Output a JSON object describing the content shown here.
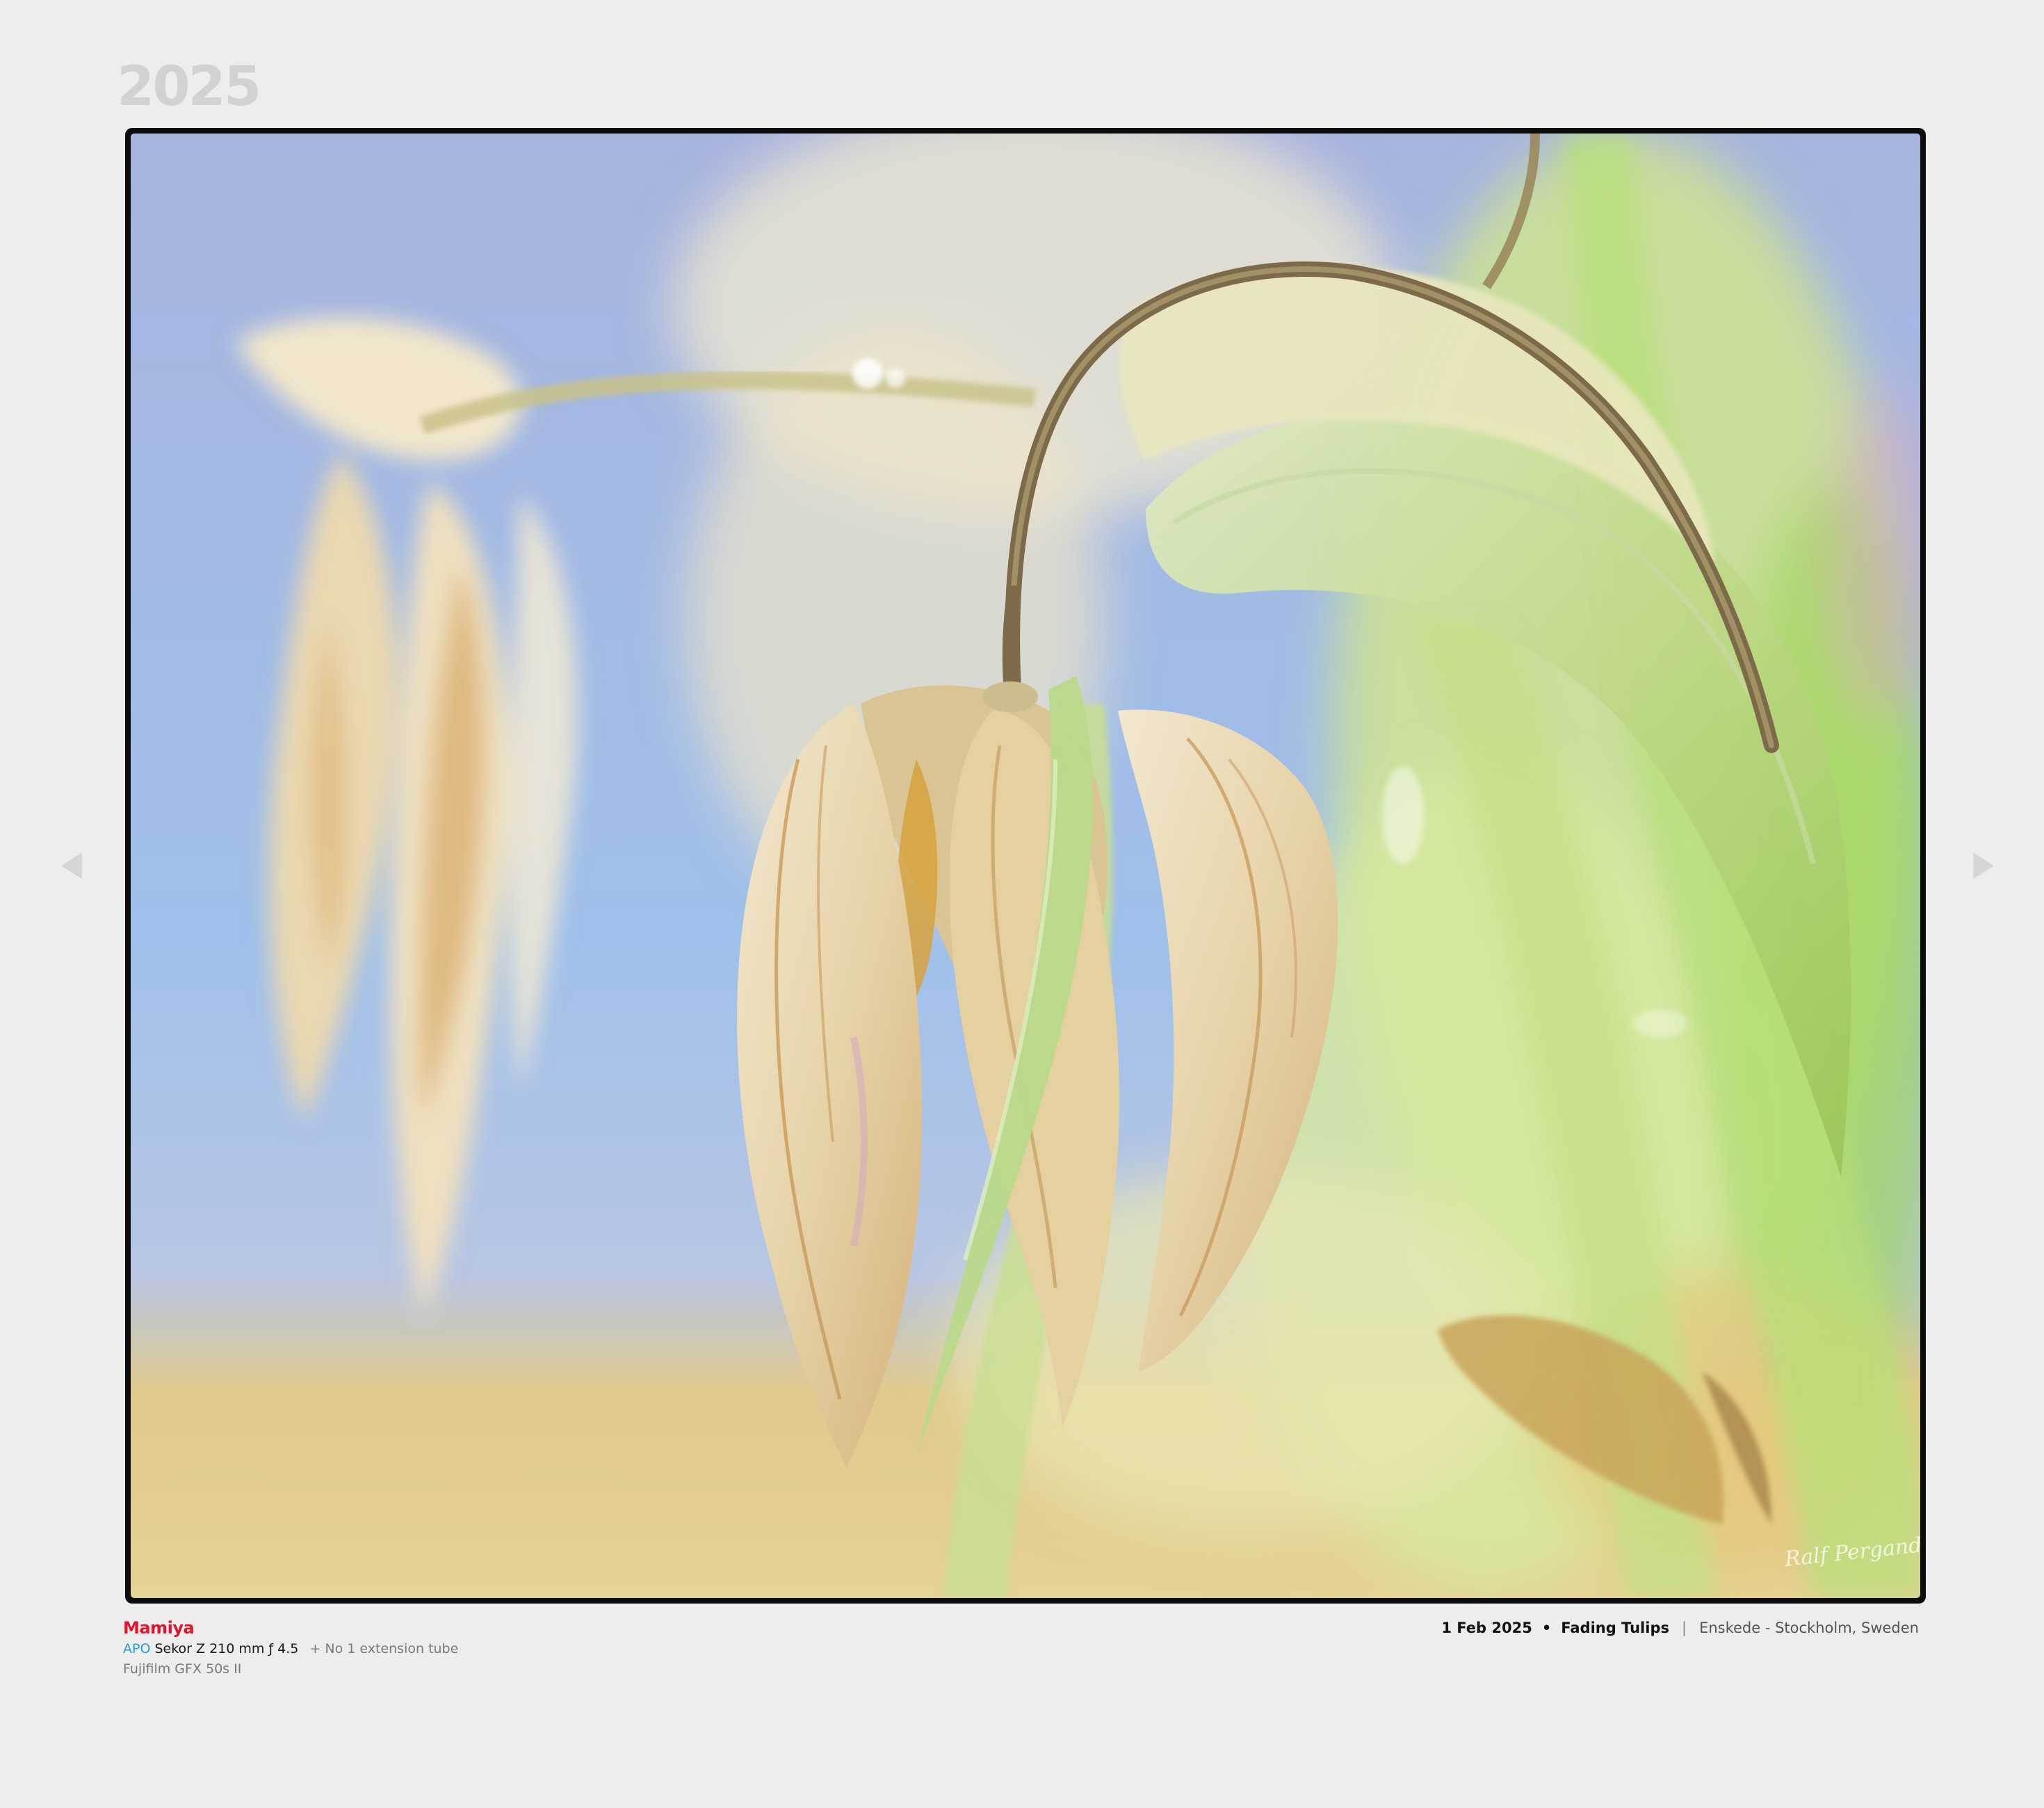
{
  "header": {
    "year": "2025"
  },
  "photo": {
    "subject": "Dried drooping tulip blossoms with green stems and leaves against a soft blue background",
    "signature": "Ralf Pergande",
    "colors": {
      "sky_blue": "#9fb6e2",
      "petal_cream": "#efe4c6",
      "stem_green": "#b6d66a",
      "sand": "#e2cc8a"
    }
  },
  "navigation": {
    "prev_icon": "triangle-left-icon",
    "next_icon": "triangle-right-icon"
  },
  "equipment": {
    "lens_brand": "Mamiya",
    "lens_prefix": "APO",
    "lens_name": "Sekor Z 210 mm ƒ 4.5",
    "lens_extra": "+ No 1 extension tube",
    "camera": "Fujifilm GFX 50s II"
  },
  "details": {
    "date": "1 Feb 2025",
    "dot": "•",
    "title": "Fading Tulips",
    "bar": "|",
    "location": "Enskede - Stockholm, Sweden"
  }
}
